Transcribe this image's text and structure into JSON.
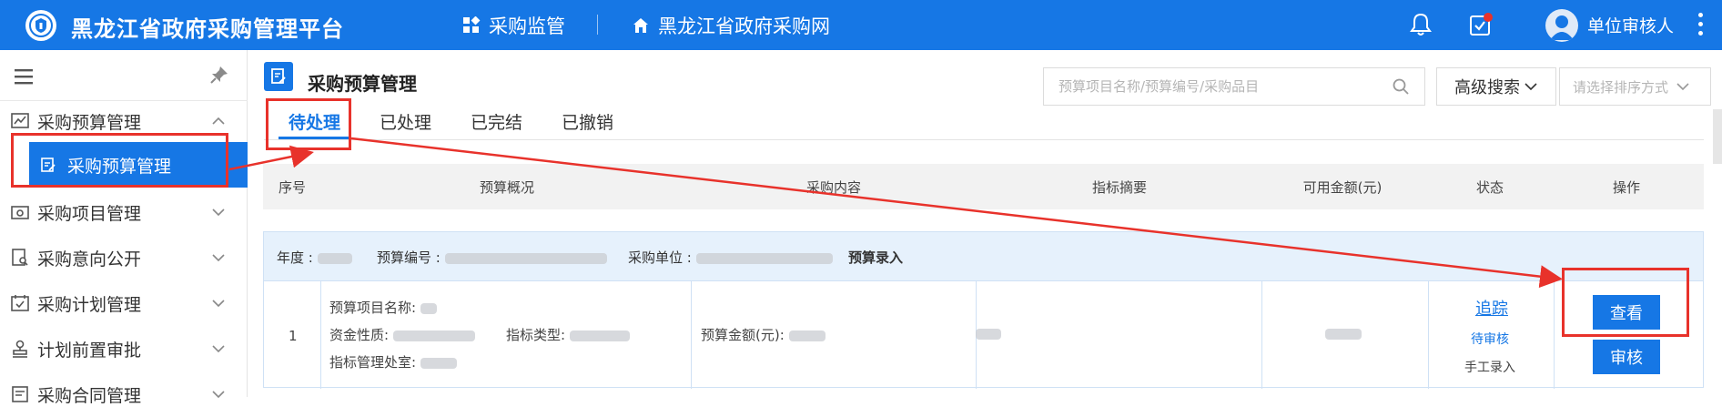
{
  "header": {
    "app_title": "黑龙江省政府采购管理平台",
    "nav_primary": "采购监管",
    "nav_secondary": "黑龙江省政府采购网",
    "user_name": "单位审核人"
  },
  "sidebar": {
    "items": [
      {
        "label": "采购预算管理",
        "icon": "chart-icon",
        "expanded": true
      },
      {
        "label": "采购预算管理",
        "icon": "edit-doc-icon",
        "selected": true
      },
      {
        "label": "采购项目管理",
        "icon": "folder-camera-icon"
      },
      {
        "label": "采购意向公开",
        "icon": "doc-search-icon"
      },
      {
        "label": "采购计划管理",
        "icon": "calendar-check-icon"
      },
      {
        "label": "计划前置审批",
        "icon": "stamp-icon"
      },
      {
        "label": "采购合同管理",
        "icon": "contract-icon"
      }
    ]
  },
  "main": {
    "title": "采购预算管理",
    "search_placeholder": "预算项目名称/预算编号/采购品目",
    "advanced_search": "高级搜索",
    "sort_placeholder": "请选择排序方式",
    "tabs": [
      {
        "label": "待处理",
        "active": true
      },
      {
        "label": "已处理"
      },
      {
        "label": "已完结"
      },
      {
        "label": "已撤销"
      }
    ],
    "columns": [
      "序号",
      "预算概况",
      "采购内容",
      "指标摘要",
      "可用金额(元)",
      "状态",
      "操作"
    ],
    "group": {
      "year_label": "年度 :",
      "budget_no_label": "预算编号 :",
      "unit_label": "采购单位 :",
      "entry_label": "预算录入"
    },
    "row": {
      "index": "1",
      "project_name_label": "预算项目名称:",
      "fund_nature_label": "资金性质:",
      "indicator_type_label": "指标类型:",
      "indicator_office_label": "指标管理处室:",
      "budget_amount_label": "预算金额(元):",
      "track_link": "追踪",
      "status": "待审核",
      "entry_type": "手工录入",
      "view_button": "查看",
      "review_button": "审核"
    }
  },
  "colors": {
    "primary": "#1677e5",
    "annotation": "#e8322b"
  }
}
